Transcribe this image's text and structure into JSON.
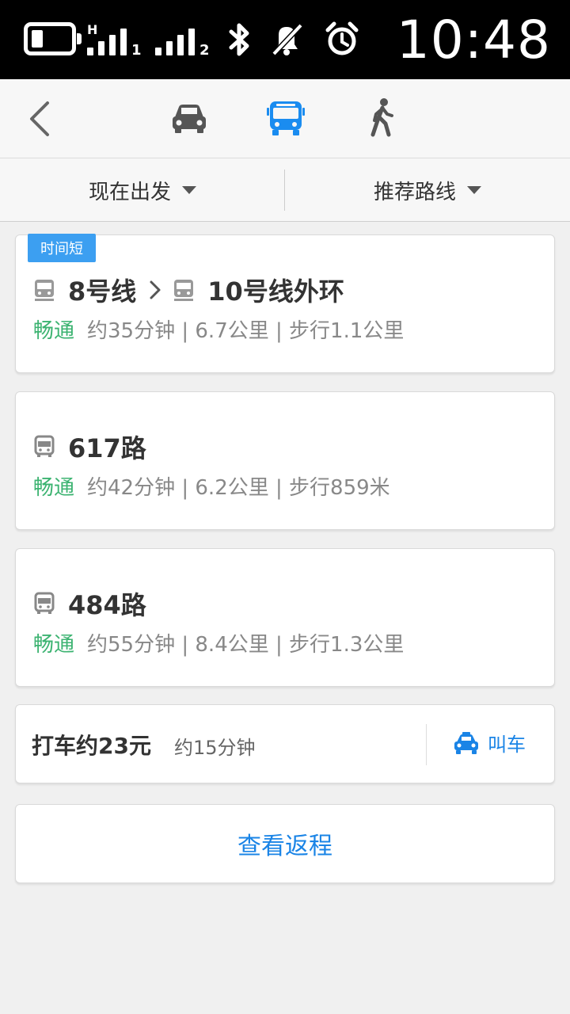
{
  "status_bar": {
    "time": "10:48",
    "signal1_label": "H",
    "signal1_sub": "1",
    "signal2_sub": "2",
    "icons": [
      "battery-icon",
      "signal-icon",
      "signal-icon",
      "bluetooth-icon",
      "mute-icon",
      "alarm-icon"
    ]
  },
  "nav": {
    "modes": [
      {
        "name": "car",
        "icon": "car-icon",
        "active": false
      },
      {
        "name": "bus",
        "icon": "bus-icon",
        "active": true
      },
      {
        "name": "walk",
        "icon": "walk-icon",
        "active": false
      }
    ],
    "active_color": "#1a8cf0"
  },
  "filters": {
    "depart": "现在出发",
    "route_pref": "推荐路线"
  },
  "routes": [
    {
      "badge": "时间短",
      "segments": [
        "8号线",
        "10号线外环"
      ],
      "segment_icons": [
        "subway-icon",
        "subway-icon"
      ],
      "status": "畅通",
      "meta": "约35分钟 | 6.7公里 | 步行1.1公里"
    },
    {
      "segments": [
        "617路"
      ],
      "segment_icons": [
        "bus-icon"
      ],
      "status": "畅通",
      "meta": "约42分钟 | 6.2公里 | 步行859米"
    },
    {
      "segments": [
        "484路"
      ],
      "segment_icons": [
        "bus-icon"
      ],
      "status": "畅通",
      "meta": "约55分钟 | 8.4公里 | 步行1.3公里"
    }
  ],
  "taxi": {
    "price": "打车约23元",
    "time": "约15分钟",
    "call_label": "叫车"
  },
  "return_trip": "查看返程",
  "colors": {
    "status_green": "#3cb371",
    "accent_blue": "#1a84e6",
    "badge_blue": "#3c9ff1"
  }
}
